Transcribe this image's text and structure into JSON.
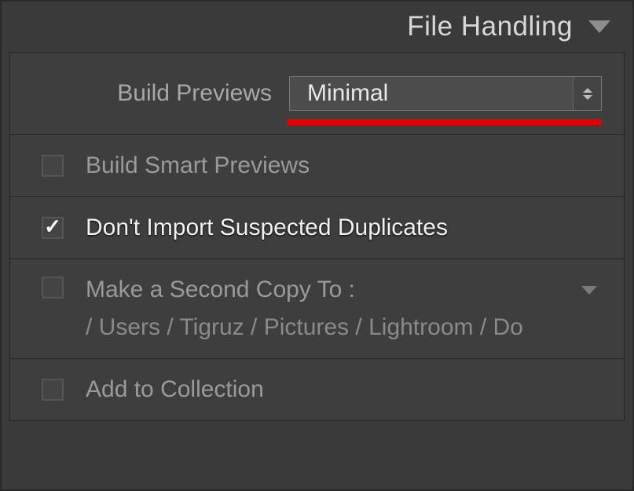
{
  "header": {
    "title": "File Handling"
  },
  "buildPreviews": {
    "label": "Build Previews",
    "value": "Minimal"
  },
  "smartPreviews": {
    "label": "Build Smart Previews",
    "checked": false
  },
  "duplicates": {
    "label": "Don't Import Suspected Duplicates",
    "checked": true
  },
  "secondCopy": {
    "label": "Make a Second Copy To :",
    "path": "/ Users / Tigruz / Pictures / Lightroom / Do",
    "checked": false
  },
  "addToCollection": {
    "label": "Add to Collection",
    "checked": false
  }
}
